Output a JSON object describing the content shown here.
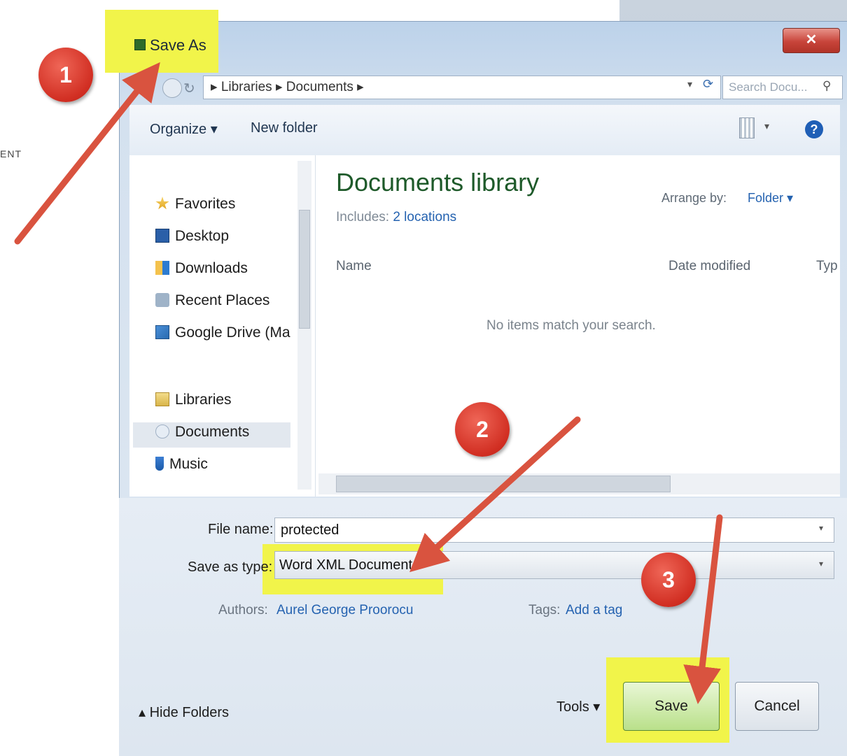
{
  "background": {
    "edge_text": "ENT"
  },
  "dialog": {
    "title": "Save As",
    "close_label": "✕"
  },
  "address": {
    "path": "▸ Libraries ▸ Documents ▸",
    "search_placeholder": "Search Docu...",
    "refresh_icon": "refresh-icon",
    "search_icon": "magnifier-icon"
  },
  "toolbar": {
    "organize": "Organize ▾",
    "new_folder": "New folder",
    "views_arrow": "▾",
    "help": "?"
  },
  "nav_pane": {
    "items": [
      {
        "label": "Favorites",
        "icon": "star-icon"
      },
      {
        "label": "Desktop",
        "icon": "desktop-icon"
      },
      {
        "label": "Downloads",
        "icon": "downloads-icon"
      },
      {
        "label": "Recent Places",
        "icon": "recent-places-icon"
      },
      {
        "label": "Google Drive (Ma",
        "icon": "google-drive-icon"
      },
      {
        "label": "Libraries",
        "icon": "libraries-icon"
      },
      {
        "label": "Documents",
        "icon": "documents-icon"
      },
      {
        "label": "Music",
        "icon": "music-icon"
      }
    ],
    "selected": "Documents"
  },
  "library": {
    "title": "Documents library",
    "includes_label": "Includes:",
    "includes_link": "2 locations",
    "arrange_label": "Arrange by:",
    "arrange_value": "Folder ▾",
    "columns": [
      "Name",
      "Date modified",
      "Typ"
    ],
    "empty_message": "No items match your search."
  },
  "form": {
    "file_name_label": "File name:",
    "file_name_value": "protected",
    "save_type_label": "Save as type:",
    "save_type_value": "Word XML Document",
    "authors_label": "Authors:",
    "authors_value": "Aurel George Proorocu",
    "tags_label": "Tags:",
    "tags_value": "Add a tag"
  },
  "footer": {
    "hide_folders": "▴ Hide Folders",
    "tools": "Tools ▾",
    "save": "Save",
    "cancel": "Cancel"
  },
  "callouts": [
    "1",
    "2",
    "3"
  ],
  "colors": {
    "highlight": "#f1f44a",
    "callout": "#d12e22",
    "arrow": "#d9533f",
    "library_title": "#1e5a2a",
    "link": "#2462b0"
  }
}
